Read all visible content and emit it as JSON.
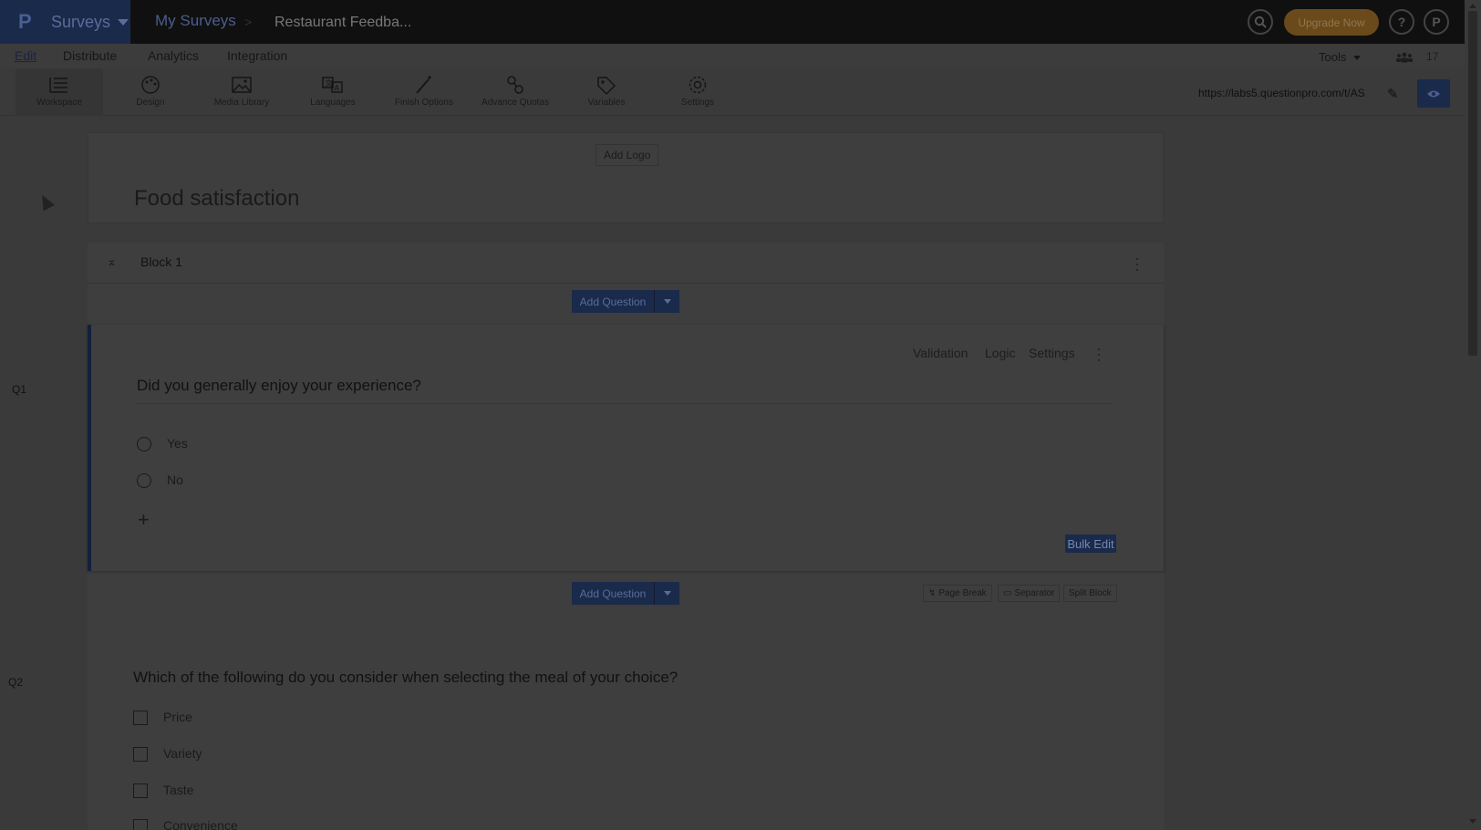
{
  "app": {
    "brand": "Surveys",
    "breadcrumb": {
      "root": "My Surveys",
      "separator": ">",
      "current": "Restaurant Feedba..."
    },
    "upgrade_label": "Upgrade Now",
    "help_label": "?",
    "profile_initial": "P"
  },
  "menu": {
    "items": [
      "Edit",
      "Distribute",
      "Analytics",
      "Integration"
    ],
    "active": "Edit",
    "tools_label": "Tools",
    "users_count": "17"
  },
  "toolbar": {
    "tools": [
      {
        "label": "Workspace",
        "icon": "workspace-icon"
      },
      {
        "label": "Design",
        "icon": "palette-icon"
      },
      {
        "label": "Media Library",
        "icon": "image-icon"
      },
      {
        "label": "Languages",
        "icon": "translate-icon"
      },
      {
        "label": "Finish Options",
        "icon": "magic-wand-icon"
      },
      {
        "label": "Advance Quotas",
        "icon": "quota-icon"
      },
      {
        "label": "Variables",
        "icon": "tag-icon"
      },
      {
        "label": "Settings",
        "icon": "gear-icon"
      }
    ],
    "survey_url": "https://labs5.questionpro.com/t/AS"
  },
  "survey": {
    "add_logo_label": "Add Logo",
    "title": "Food satisfaction",
    "block_title": "Block 1",
    "add_question_label": "Add Question",
    "q1": {
      "number": "Q1",
      "text": "Did you generally enjoy your experience?",
      "actions": [
        "Validation",
        "Logic",
        "Settings"
      ],
      "options": [
        "Yes",
        "No"
      ],
      "bulk_edit_label": "Bulk Edit"
    },
    "between_actions": [
      "Page Break",
      "Separator",
      "Split Block"
    ],
    "q2": {
      "number": "Q2",
      "text": "Which of the following do you consider when selecting the meal of your choice?",
      "options": [
        "Price",
        "Variety",
        "Taste",
        "Convenience"
      ]
    }
  },
  "colors": {
    "brand_dark": "#1a2a4a",
    "upgrade": "#6a4a1a",
    "overlay_dark": "#3a3a3a"
  }
}
